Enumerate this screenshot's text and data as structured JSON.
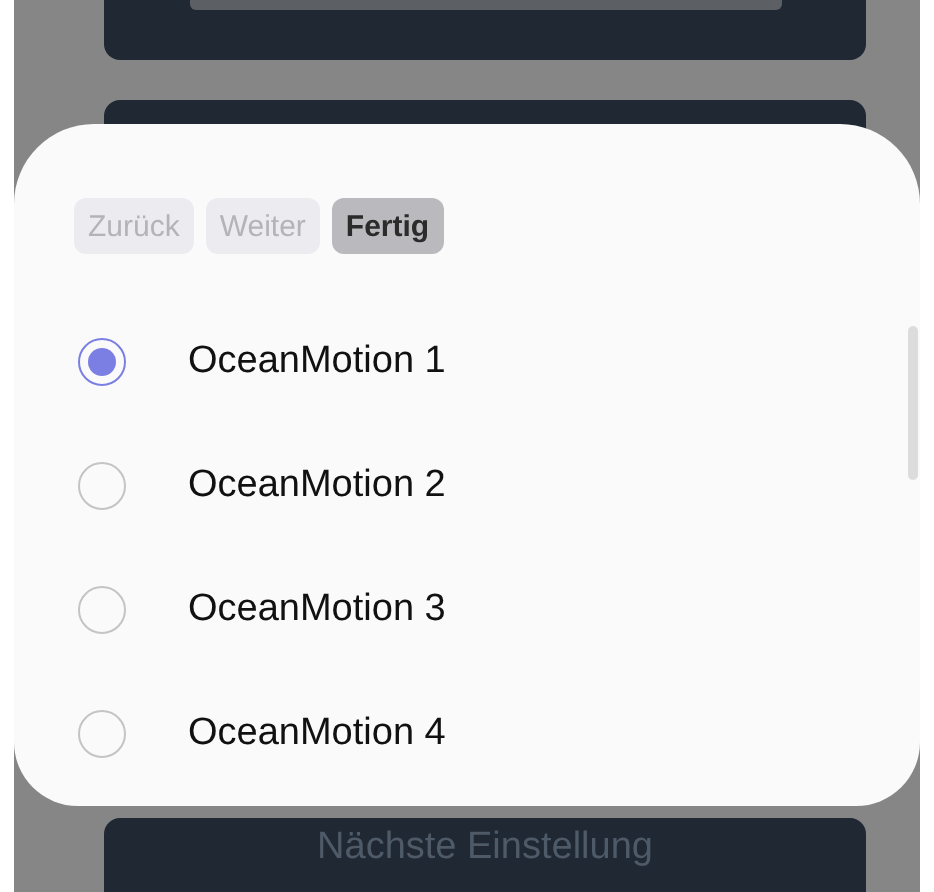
{
  "sheet": {
    "buttons": [
      {
        "label": "Zurück",
        "disabled": true
      },
      {
        "label": "Weiter",
        "disabled": true
      },
      {
        "label": "Fertig",
        "disabled": false
      }
    ],
    "options": [
      {
        "label": "OceanMotion 1",
        "selected": true
      },
      {
        "label": "OceanMotion 2",
        "selected": false
      },
      {
        "label": "OceanMotion 3",
        "selected": false
      },
      {
        "label": "OceanMotion 4",
        "selected": false
      }
    ]
  },
  "background": {
    "next_button": "Nächste Einstellung"
  }
}
